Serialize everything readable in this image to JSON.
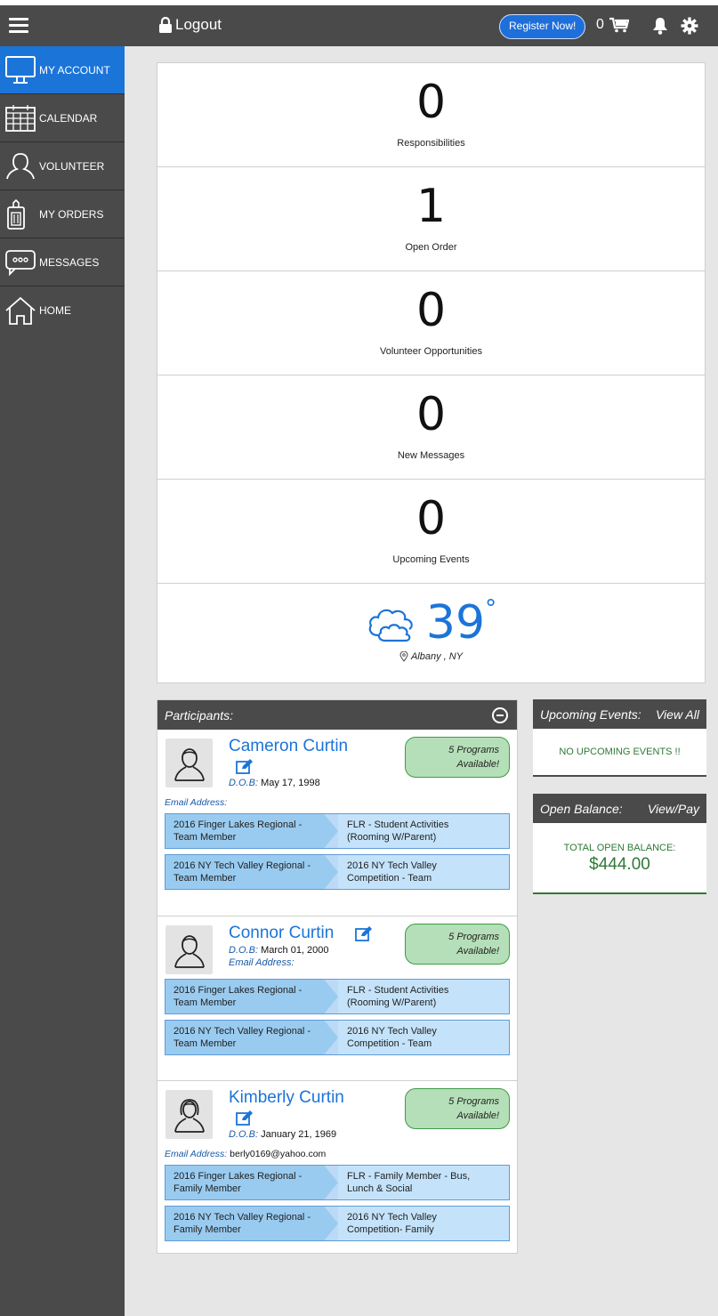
{
  "header": {
    "logout_label": "Logout",
    "register_label": "Register Now!",
    "cart_count": "0"
  },
  "sidebar": {
    "items": [
      {
        "label": "MY ACCOUNT",
        "icon": "monitor-icon",
        "active": true
      },
      {
        "label": "CALENDAR",
        "icon": "calendar-icon"
      },
      {
        "label": "VOLUNTEER",
        "icon": "person-icon"
      },
      {
        "label": "MY ORDERS",
        "icon": "orders-icon"
      },
      {
        "label": "MESSAGES",
        "icon": "message-icon"
      },
      {
        "label": "HOME",
        "icon": "home-icon"
      }
    ]
  },
  "stats": [
    {
      "value": "0",
      "label": "Responsibilities"
    },
    {
      "value": "1",
      "label": "Open Order"
    },
    {
      "value": "0",
      "label": "Volunteer Opportunities"
    },
    {
      "value": "0",
      "label": "New Messages"
    },
    {
      "value": "0",
      "label": "Upcoming Events"
    }
  ],
  "weather": {
    "temp": "39",
    "unit": "°",
    "location": "Albany , NY"
  },
  "participants": {
    "title": "Participants:",
    "dob_label": "D.O.B:",
    "email_label": "Email Address:",
    "people": [
      {
        "name": "Cameron Curtin",
        "dob": "May 17, 1998",
        "email": "",
        "programs_line1": "5 Programs",
        "programs_line2": "Available!",
        "registrations": [
          {
            "event_line1": "2016 Finger Lakes Regional -",
            "event_line2": "Team Member",
            "activity_line1": "FLR - Student Activities",
            "activity_line2": "(Rooming W/Parent)"
          },
          {
            "event_line1": "2016 NY Tech Valley Regional -",
            "event_line2": "Team Member",
            "activity_line1": "2016 NY Tech Valley",
            "activity_line2": "Competition - Team"
          }
        ]
      },
      {
        "name": "Connor Curtin",
        "dob": "March 01, 2000",
        "email": "",
        "programs_line1": "5 Programs",
        "programs_line2": "Available!",
        "registrations": [
          {
            "event_line1": "2016 Finger Lakes Regional -",
            "event_line2": "Team Member",
            "activity_line1": "FLR - Student Activities",
            "activity_line2": "(Rooming W/Parent)"
          },
          {
            "event_line1": "2016 NY Tech Valley Regional -",
            "event_line2": "Team Member",
            "activity_line1": "2016 NY Tech Valley",
            "activity_line2": "Competition - Team"
          }
        ]
      },
      {
        "name": "Kimberly Curtin",
        "dob": "January 21, 1969",
        "email": "berly0169@yahoo.com",
        "programs_line1": "5 Programs",
        "programs_line2": "Available!",
        "registrations": [
          {
            "event_line1": "2016 Finger Lakes Regional -",
            "event_line2": "Family Member",
            "activity_line1": "FLR - Family Member - Bus,",
            "activity_line2": "Lunch & Social"
          },
          {
            "event_line1": "2016 NY Tech Valley Regional -",
            "event_line2": "Family Member",
            "activity_line1": "2016 NY Tech Valley",
            "activity_line2": "Competition- Family"
          }
        ]
      }
    ]
  },
  "upcoming_events": {
    "title": "Upcoming Events:",
    "link": "View All",
    "empty": "NO UPCOMING EVENTS !!"
  },
  "open_balance": {
    "title": "Open Balance:",
    "link": "View/Pay",
    "label": "TOTAL OPEN BALANCE:",
    "amount": "$444.00"
  },
  "colors": {
    "accent": "#1b74d8",
    "dark": "#4a4a4a",
    "green": "#2e7a36"
  }
}
